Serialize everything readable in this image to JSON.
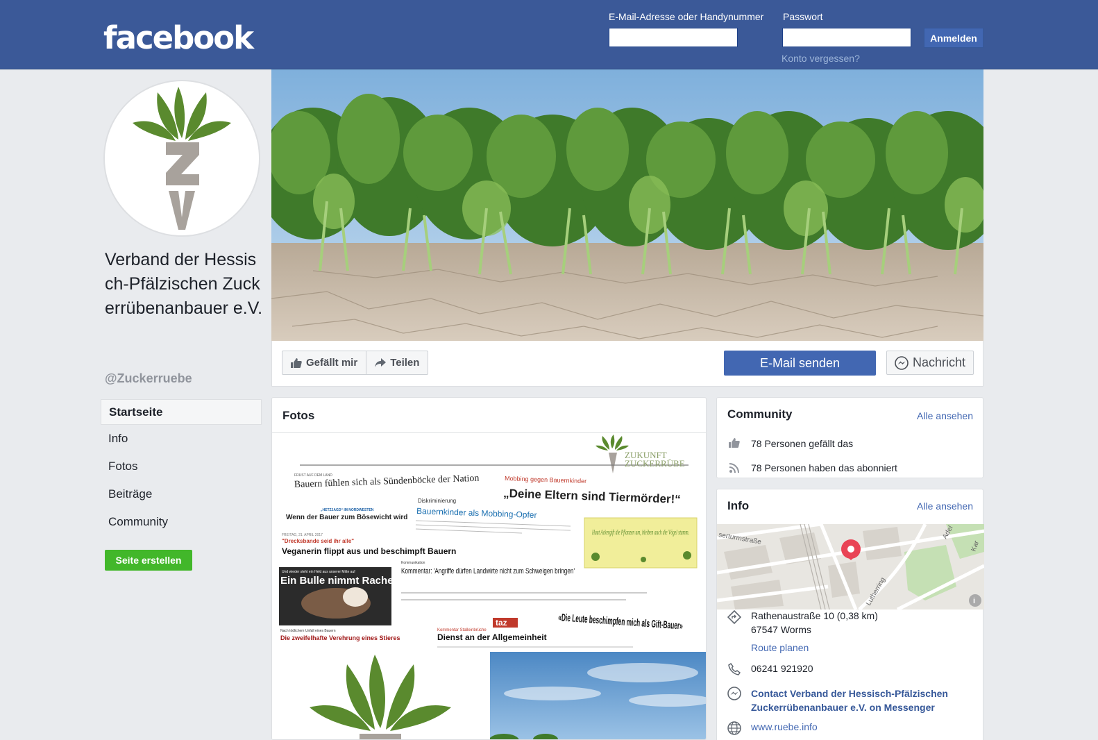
{
  "header": {
    "logo": "facebook",
    "email_label": "E-Mail-Adresse oder Handynummer",
    "password_label": "Passwort",
    "login_button": "Anmelden",
    "forgot_link": "Konto vergessen?"
  },
  "page": {
    "name": "Verband der Hessisch-Pfälzischen Zuckerrübenanbauer e.V.",
    "handle": "@Zuckerruebe",
    "logo_letters": "ZV"
  },
  "nav": {
    "items": [
      "Startseite",
      "Info",
      "Fotos",
      "Beiträge",
      "Community"
    ],
    "create_page": "Seite erstellen"
  },
  "actions": {
    "like": "Gefällt mir",
    "share": "Teilen",
    "email": "E-Mail senden",
    "message": "Nachricht"
  },
  "photos": {
    "title": "Fotos",
    "collage": {
      "brand_line1": "ZUKUNFT",
      "brand_line2": "ZUCKERRÜBE",
      "kicker1": "FRUST AUF DEM LAND",
      "headline1": "Bauern fühlen sich als Sündenböcke der Nation",
      "kicker2": "Mobbing gegen Bauernkinder",
      "headline2": "„Deine Eltern sind Tiermörder!“",
      "kicker3": "„HETZJAGD“ IM NORDWESTEN",
      "headline3": "Wenn der Bauer zum Bösewicht wird",
      "kicker4": "Diskriminierung",
      "headline4": "Bauernkinder als Mobbing-Opfer",
      "date": "FREITAG, 21. APRIL 2017",
      "quote1": "\"Drecksbande seid ihr alle\"",
      "headline5": "Veganerin flippt aus und beschimpft Bauern",
      "note": "Haut Ackergift die Pflanzen um, bleiben auch die Vögel stumm.",
      "kicker5": "Kommunikation",
      "headline6": "Kommentar: 'Angriffe dürfen Landwirte nicht zum Schweigen bringen'",
      "bull_kicker": "Und wieder steht ein Held aus unserer Mitte auf",
      "bull_title": "Ein Bulle nimmt Rache",
      "bull_sub": "Nach tödlichem Unfall eines Bauern",
      "bull_caption": "Die zweifelhafte Verehrung eines Stieres",
      "taz": "taz",
      "taz_kicker": "Kommentar Stalleinbrüche",
      "taz_title": "Dienst an der Allgemeinheit",
      "quote2": "«Die Leute beschimpfen mich als Gift-Bauer»"
    }
  },
  "community": {
    "title": "Community",
    "see_all": "Alle ansehen",
    "likes": "78 Personen gefällt das",
    "follows": "78 Personen haben das abonniert"
  },
  "info": {
    "title": "Info",
    "see_all": "Alle ansehen",
    "map_street1": "serturmstraße",
    "map_street2": "Lutherring",
    "map_street3": "Adel",
    "map_street4": "Kar",
    "address_line1": "Rathenaustraße 10 (0,38 km)",
    "address_line2": "67547 Worms",
    "route": "Route planen",
    "phone": "06241 921920",
    "messenger": "Contact Verband der Hessisch-Pfälzischen Zuckerrübenanbauer e.V. on Messenger",
    "website": "www.ruebe.info"
  },
  "colors": {
    "brand_blue": "#3b5998",
    "button_blue": "#4267b2",
    "green": "#42b72a",
    "leaf_green": "#5a8a2e",
    "beet_gray": "#a8a29c"
  }
}
